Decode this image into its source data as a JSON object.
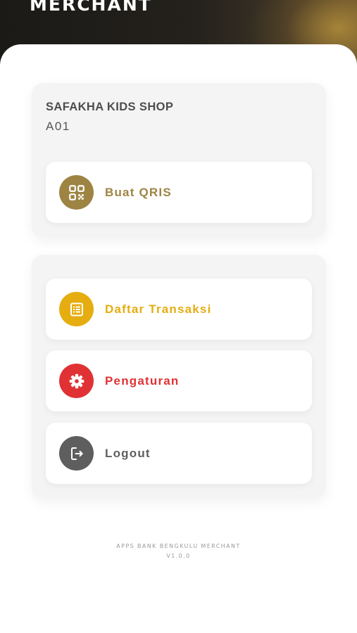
{
  "header": {
    "title": "MERCHANT"
  },
  "merchant": {
    "name": "SAFAKHA KIDS SHOP",
    "code": "A01"
  },
  "menu": {
    "qris": {
      "label": "Buat QRIS",
      "color": "#9e8442",
      "icon": "qr-code-icon"
    },
    "transaksi": {
      "label": "Daftar Transaksi",
      "color": "#e5ad10",
      "icon": "list-icon"
    },
    "pengaturan": {
      "label": "Pengaturan",
      "color": "#e03234",
      "icon": "gear-icon"
    },
    "logout": {
      "label": "Logout",
      "color": "#5e5e5e",
      "icon": "logout-icon"
    }
  },
  "footer": {
    "app_name": "APPS BANK BENGKULU MERCHANT",
    "version": "V1.0.0"
  }
}
